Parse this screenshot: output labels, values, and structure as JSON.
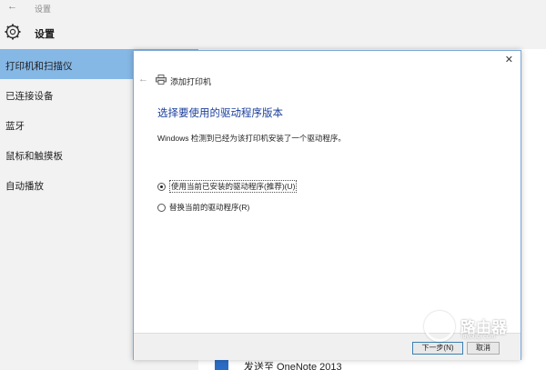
{
  "window": {
    "title": "设置",
    "back_icon": "back-arrow-icon"
  },
  "header": {
    "title": "设置",
    "icon": "gear-icon"
  },
  "sidebar": {
    "items": [
      {
        "label": "打印机和扫描仪",
        "active": true
      },
      {
        "label": "已连接设备"
      },
      {
        "label": "蓝牙"
      },
      {
        "label": "鼠标和触摸板"
      },
      {
        "label": "自动播放"
      }
    ]
  },
  "main": {
    "partial_item_label": "发送至 OneNote 2013"
  },
  "dialog": {
    "title": "添加打印机",
    "heading": "选择要使用的驱动程序版本",
    "info": "Windows 检测到已经为该打印机安装了一个驱动程序。",
    "options": [
      {
        "label": "使用当前已安装的驱动程序(推荐)(U)",
        "checked": true
      },
      {
        "label": "替换当前的驱动程序(R)",
        "checked": false
      }
    ],
    "next_label": "下一步(N)",
    "cancel_label": "取消",
    "close_icon": "close-icon"
  },
  "watermark": {
    "text": "路由器",
    "sub": "luyouqi.com"
  },
  "colors": {
    "accent": "#86b8e6",
    "heading": "#1a3e9c",
    "sidebar_bg": "#f2f2f2"
  }
}
